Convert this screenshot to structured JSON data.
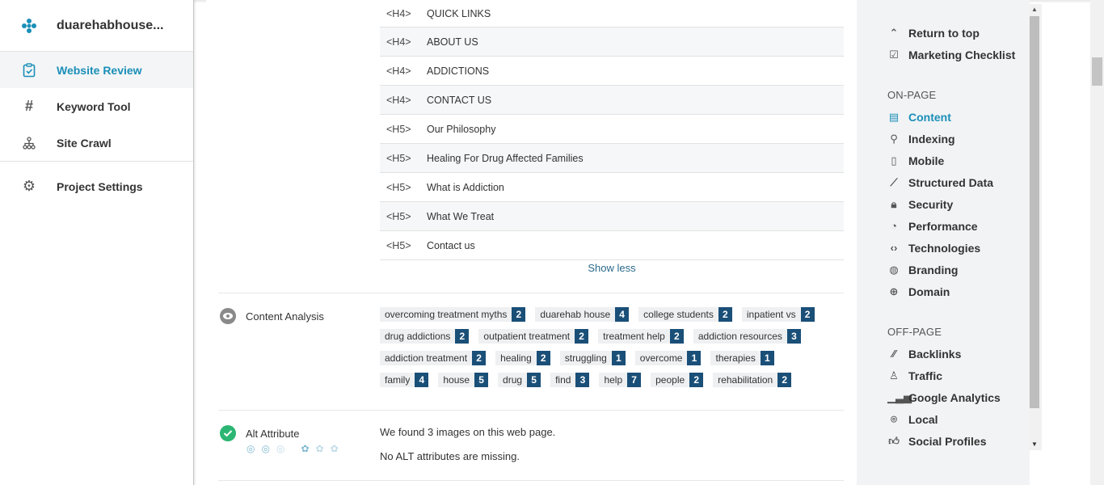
{
  "sidebar": {
    "project_name": "duarehabhouse...",
    "items": [
      {
        "label": "Website Review",
        "icon": "clipboard-check-icon"
      },
      {
        "label": "Keyword Tool",
        "icon": "hash-icon"
      },
      {
        "label": "Site Crawl",
        "icon": "sitemap-icon"
      },
      {
        "label": "Project Settings",
        "icon": "gear-icon"
      }
    ]
  },
  "headings": [
    {
      "tag": "<H4>",
      "text": "QUICK LINKS"
    },
    {
      "tag": "<H4>",
      "text": "ABOUT US"
    },
    {
      "tag": "<H4>",
      "text": "ADDICTIONS"
    },
    {
      "tag": "<H4>",
      "text": "CONTACT US"
    },
    {
      "tag": "<H5>",
      "text": "Our Philosophy"
    },
    {
      "tag": "<H5>",
      "text": "Healing For Drug Affected Families"
    },
    {
      "tag": "<H5>",
      "text": "What is Addiction"
    },
    {
      "tag": "<H5>",
      "text": "What We Treat"
    },
    {
      "tag": "<H5>",
      "text": "Contact us"
    }
  ],
  "show_less": "Show less",
  "content_analysis": {
    "title": "Content Analysis",
    "keywords": [
      [
        {
          "w": "overcoming treatment myths",
          "c": "2"
        },
        {
          "w": "duarehab house",
          "c": "4"
        },
        {
          "w": "college students",
          "c": "2"
        },
        {
          "w": "inpatient vs",
          "c": "2"
        }
      ],
      [
        {
          "w": "drug addictions",
          "c": "2"
        },
        {
          "w": "outpatient treatment",
          "c": "2"
        },
        {
          "w": "treatment help",
          "c": "2"
        },
        {
          "w": "addiction resources",
          "c": "3"
        }
      ],
      [
        {
          "w": "addiction treatment",
          "c": "2"
        },
        {
          "w": "healing",
          "c": "2"
        },
        {
          "w": "struggling",
          "c": "1"
        },
        {
          "w": "overcome",
          "c": "1"
        },
        {
          "w": "therapies",
          "c": "1"
        }
      ],
      [
        {
          "w": "family",
          "c": "4"
        },
        {
          "w": "house",
          "c": "5"
        },
        {
          "w": "drug",
          "c": "5"
        },
        {
          "w": "find",
          "c": "3"
        },
        {
          "w": "help",
          "c": "7"
        },
        {
          "w": "people",
          "c": "2"
        },
        {
          "w": "rehabilitation",
          "c": "2"
        }
      ]
    ]
  },
  "alt_attribute": {
    "title": "Alt Attribute",
    "line1": "We found 3 images on this web page.",
    "line2": "No ALT attributes are missing."
  },
  "right_nav": {
    "top": [
      {
        "label": "Return to top",
        "icon": "chevron-up-icon"
      },
      {
        "label": "Marketing Checklist",
        "icon": "checkbox-icon"
      }
    ],
    "on_page_title": "ON-PAGE",
    "on_page": [
      {
        "label": "Content",
        "icon": "document-icon"
      },
      {
        "label": "Indexing",
        "icon": "search-icon"
      },
      {
        "label": "Mobile",
        "icon": "mobile-icon"
      },
      {
        "label": "Structured Data",
        "icon": "graph-icon"
      },
      {
        "label": "Security",
        "icon": "lock-icon"
      },
      {
        "label": "Performance",
        "icon": "speedometer-icon"
      },
      {
        "label": "Technologies",
        "icon": "code-icon"
      },
      {
        "label": "Branding",
        "icon": "fingerprint-icon"
      },
      {
        "label": "Domain",
        "icon": "globe-icon"
      }
    ],
    "off_page_title": "OFF-PAGE",
    "off_page": [
      {
        "label": "Backlinks",
        "icon": "backlinks-icon"
      },
      {
        "label": "Traffic",
        "icon": "traffic-icon"
      },
      {
        "label": "Google Analytics",
        "icon": "bar-chart-icon"
      },
      {
        "label": "Local",
        "icon": "location-pin-icon"
      },
      {
        "label": "Social Profiles",
        "icon": "thumbs-up-icon"
      }
    ]
  },
  "colors": {
    "accent": "#1a8fb7",
    "badge": "#1a4f78",
    "success": "#2bb673"
  }
}
